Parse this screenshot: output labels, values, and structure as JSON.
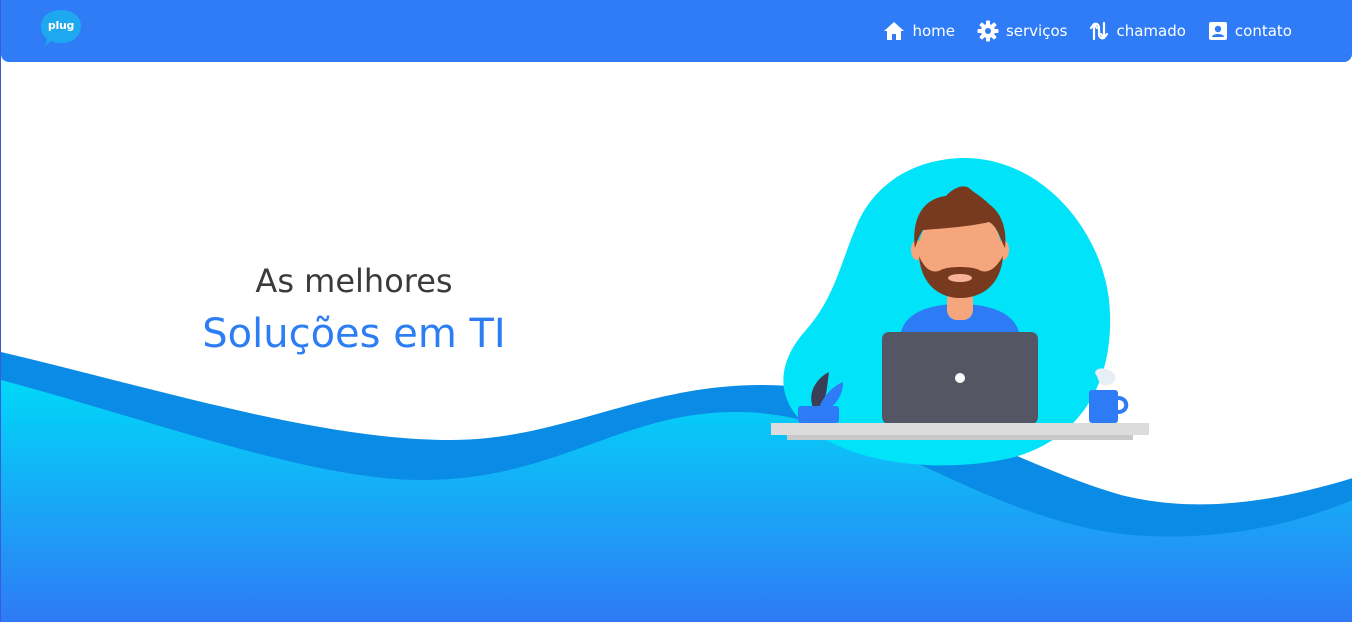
{
  "brand": {
    "logo_text": "plug",
    "logo_color": "#1ea8f0"
  },
  "nav": {
    "items": [
      {
        "label": "home",
        "icon": "home-icon"
      },
      {
        "label": "serviços",
        "icon": "gear-icon"
      },
      {
        "label": "chamado",
        "icon": "switch-arrows-icon"
      },
      {
        "label": "contato",
        "icon": "contact-card-icon"
      }
    ]
  },
  "hero": {
    "line1": "As melhores",
    "line2": "Soluções em TI"
  },
  "colors": {
    "navbar": "#2f7cf6",
    "accent": "#2d7ef5",
    "wave_light": "#00d4f6",
    "wave_dark": "#0a8de6",
    "blob": "#00e0f7"
  }
}
